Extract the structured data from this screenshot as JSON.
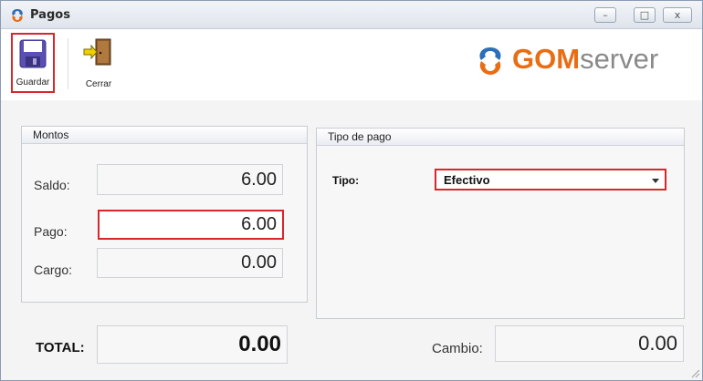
{
  "window": {
    "title": "Pagos",
    "minimize": "–",
    "maximize": "□",
    "close": "x"
  },
  "toolbar": {
    "save_label": "Guardar",
    "close_label": "Cerrar"
  },
  "logo": {
    "brand": "GOM",
    "suffix": "server"
  },
  "montos": {
    "header": "Montos",
    "saldo_label": "Saldo:",
    "saldo_value": "6.00",
    "pago_label": "Pago:",
    "pago_value": "6.00",
    "cargo_label": "Cargo:",
    "cargo_value": "0.00"
  },
  "tipo_pago": {
    "header": "Tipo de pago",
    "tipo_label": "Tipo:",
    "tipo_value": "Efectivo"
  },
  "totals": {
    "total_label": "TOTAL:",
    "total_value": "0.00",
    "cambio_label": "Cambio:",
    "cambio_value": "0.00"
  },
  "colors": {
    "accent": "#e96d12",
    "highlight": "#d9262b",
    "gray_text": "#8a8a8a"
  },
  "icons": {
    "app": "gomserver-logo-icon",
    "save": "floppy-disk-icon",
    "close": "exit-door-icon"
  }
}
